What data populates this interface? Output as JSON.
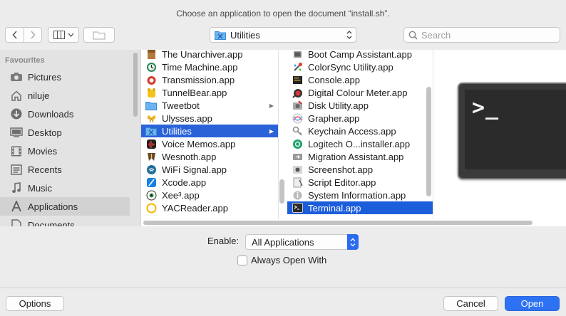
{
  "window": {
    "title": "Choose an application to open the document “install.sh”."
  },
  "toolbar": {
    "location": "Utilities",
    "search_placeholder": "Search"
  },
  "sidebar": {
    "heading": "Favourites",
    "items": [
      {
        "label": "Pictures",
        "icon": "camera-icon"
      },
      {
        "label": "niluje",
        "icon": "home-icon"
      },
      {
        "label": "Downloads",
        "icon": "download-icon"
      },
      {
        "label": "Desktop",
        "icon": "desktop-icon"
      },
      {
        "label": "Movies",
        "icon": "film-icon"
      },
      {
        "label": "Recents",
        "icon": "recents-icon"
      },
      {
        "label": "Music",
        "icon": "music-icon"
      },
      {
        "label": "Applications",
        "icon": "applications-icon"
      },
      {
        "label": "Documents",
        "icon": "document-icon"
      }
    ],
    "active": "Applications"
  },
  "column1": [
    {
      "label": "The Unarchiver.app"
    },
    {
      "label": "Time Machine.app"
    },
    {
      "label": "Transmission.app"
    },
    {
      "label": "TunnelBear.app"
    },
    {
      "label": "Tweetbot"
    },
    {
      "label": "Ulysses.app"
    },
    {
      "label": "Utilities"
    },
    {
      "label": "Voice Memos.app"
    },
    {
      "label": "Wesnoth.app"
    },
    {
      "label": "WiFi Signal.app"
    },
    {
      "label": "Xcode.app"
    },
    {
      "label": "Xee³.app"
    },
    {
      "label": "YACReader.app"
    }
  ],
  "column2": [
    {
      "label": "Boot Camp Assistant.app"
    },
    {
      "label": "ColorSync Utility.app"
    },
    {
      "label": "Console.app"
    },
    {
      "label": "Digital Colour Meter.app"
    },
    {
      "label": "Disk Utility.app"
    },
    {
      "label": "Grapher.app"
    },
    {
      "label": "Keychain Access.app"
    },
    {
      "label": "Logitech O...installer.app"
    },
    {
      "label": "Migration Assistant.app"
    },
    {
      "label": "Screenshot.app"
    },
    {
      "label": "Script Editor.app"
    },
    {
      "label": "System Information.app"
    },
    {
      "label": "Terminal.app"
    }
  ],
  "preview": {
    "prompt": ">_"
  },
  "enable": {
    "label": "Enable:",
    "value": "All Applications"
  },
  "always_open": {
    "label": "Always Open With",
    "checked": false
  },
  "buttons": {
    "options": "Options",
    "cancel": "Cancel",
    "open": "Open"
  },
  "colors": {
    "accent": "#1c5ddb",
    "primary_button": "#2d72f3"
  }
}
